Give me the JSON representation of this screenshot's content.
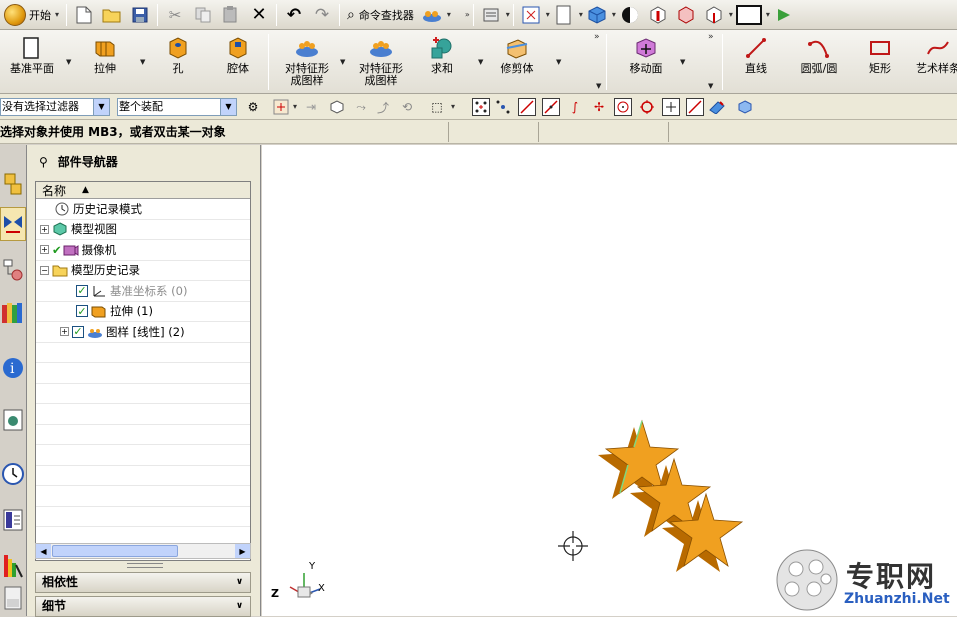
{
  "toolbar_top": {
    "start_label": "开始",
    "command_finder_label": "命令查找器"
  },
  "toolbar_main": {
    "items": [
      {
        "label": "基准平面"
      },
      {
        "label": "拉伸"
      },
      {
        "label": "孔"
      },
      {
        "label": "腔体"
      },
      {
        "label": "对特征形\n成图样"
      },
      {
        "label": "对特征形\n成图样"
      },
      {
        "label": "求和"
      },
      {
        "label": "修剪体"
      },
      {
        "label": "移动面"
      },
      {
        "label": "直线"
      },
      {
        "label": "圆弧/圆"
      },
      {
        "label": "矩形"
      },
      {
        "label": "艺术样条"
      }
    ]
  },
  "selection_bar": {
    "filter_value": "没有选择过滤器",
    "scope_value": "整个装配"
  },
  "status": {
    "message": "选择对象并使用 MB3，或者双击某一对象"
  },
  "navigator": {
    "title": "部件导航器",
    "column_name": "名称",
    "rows": [
      {
        "label": "历史记录模式"
      },
      {
        "label": "模型视图"
      },
      {
        "label": "摄像机"
      },
      {
        "label": "模型历史记录"
      },
      {
        "label": "基准坐标系 (0)"
      },
      {
        "label": "拉伸 (1)"
      },
      {
        "label": "图样 [线性] (2)"
      }
    ],
    "panel_dependencies": "相依性",
    "panel_details": "细节"
  },
  "graphics": {
    "axis_x": "X",
    "axis_y": "Y",
    "axis_z": "Z",
    "watermark_cn": "专职网",
    "watermark_en": "Zhuanzhi.Net"
  },
  "colors": {
    "star_face": "#f0a020",
    "star_side": "#b86a00",
    "star_edge": "#7fd87f",
    "selection_blue": "#c1d3fb"
  }
}
